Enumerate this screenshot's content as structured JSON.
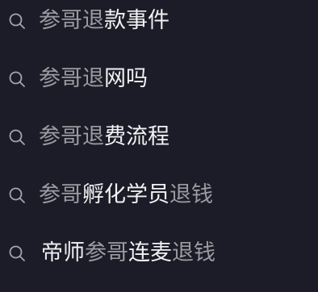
{
  "colors": {
    "background": "#1b1c27",
    "match_text": "#9b9ba2",
    "plain_text": "#f1f1f3",
    "icon": "#a4a4ac"
  },
  "suggestions": [
    {
      "icon": "search-icon",
      "segments": [
        {
          "text": "参哥退",
          "highlight": true
        },
        {
          "text": "款事件",
          "highlight": false
        }
      ]
    },
    {
      "icon": "search-icon",
      "segments": [
        {
          "text": "参哥退",
          "highlight": true
        },
        {
          "text": "网吗",
          "highlight": false
        }
      ]
    },
    {
      "icon": "search-icon",
      "segments": [
        {
          "text": "参哥退",
          "highlight": true
        },
        {
          "text": "费流程",
          "highlight": false
        }
      ]
    },
    {
      "icon": "search-icon",
      "segments": [
        {
          "text": "参哥",
          "highlight": true
        },
        {
          "text": "孵化学员",
          "highlight": false
        },
        {
          "text": "退钱",
          "highlight": true
        }
      ]
    },
    {
      "icon": "search-icon",
      "segments": [
        {
          "text": "帝师",
          "highlight": false
        },
        {
          "text": "参哥",
          "highlight": true
        },
        {
          "text": "连麦",
          "highlight": false
        },
        {
          "text": "退钱",
          "highlight": true
        }
      ]
    }
  ]
}
